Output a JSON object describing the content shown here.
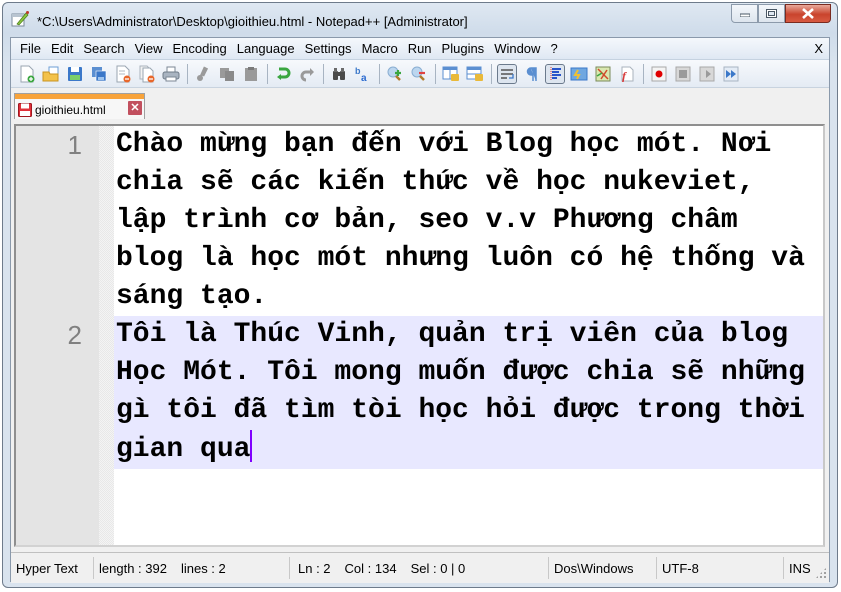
{
  "window": {
    "title": "*C:\\Users\\Administrator\\Desktop\\gioithieu.html - Notepad++ [Administrator]",
    "app_icon": "notepadpp-icon",
    "controls": {
      "minimize": "minimize",
      "maximize": "maximize",
      "close": "close"
    }
  },
  "menubar": {
    "items": [
      "File",
      "Edit",
      "Search",
      "View",
      "Encoding",
      "Language",
      "Settings",
      "Macro",
      "Run",
      "Plugins",
      "Window",
      "?"
    ],
    "close_label": "X"
  },
  "toolbar": {
    "groups": [
      [
        "new-file",
        "open-file",
        "save",
        "save-all",
        "close",
        "close-all",
        "print"
      ],
      [
        "cut",
        "copy",
        "paste"
      ],
      [
        "undo",
        "redo"
      ],
      [
        "find",
        "replace"
      ],
      [
        "zoom-in",
        "zoom-out"
      ],
      [
        "sync-vertical",
        "sync-horizontal"
      ],
      [
        "word-wrap",
        "show-all-characters",
        "indent-guide",
        "user-defined-language",
        "document-map",
        "function-list"
      ],
      [
        "macro-record",
        "macro-stop",
        "macro-play",
        "macro-run-multiple"
      ]
    ],
    "active": [
      "word-wrap",
      "indent-guide"
    ]
  },
  "tabs": [
    {
      "label": "gioithieu.html",
      "modified": true,
      "active": true,
      "accent_color": "#f8a33a"
    }
  ],
  "editor": {
    "current_line": 2,
    "current_line_bg": "#e8e8ff",
    "caret_color": "#8000ff",
    "lines": [
      {
        "number": "1",
        "text": "Chào mừng bạn đến với Blog học mót. Nơi chia sẽ các kiến thức về học nukeviet, lập trình cơ bản, seo v.v Phương châm blog là học mót nhưng luôn có hệ thống và sáng tạo."
      },
      {
        "number": "2",
        "text": "Tôi là Thúc Vinh, quản trị viên của blog Học Mót. Tôi mong muốn được chia sẽ những gì tôi đã tìm tòi học hỏi được trong thời gian qua"
      }
    ]
  },
  "statusbar": {
    "language": "Hyper Text",
    "length": "length : 392",
    "lines": "lines : 2",
    "ln": "Ln : 2",
    "col": "Col : 134",
    "sel": "Sel : 0 | 0",
    "eol": "Dos\\Windows",
    "encoding": "UTF-8",
    "mode": "INS"
  }
}
